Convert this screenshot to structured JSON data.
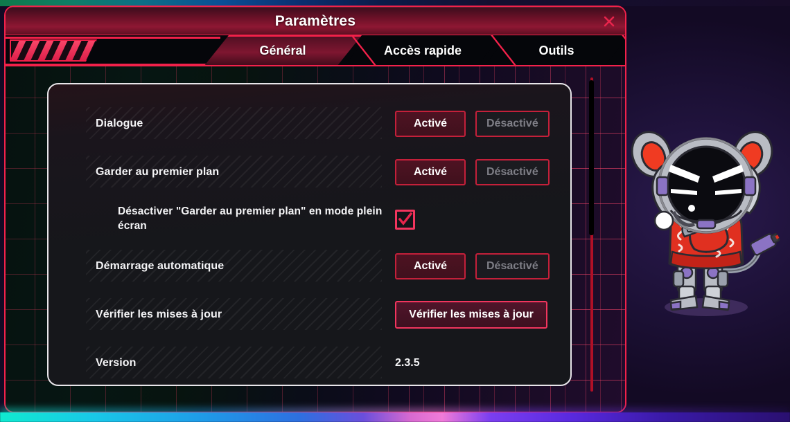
{
  "window": {
    "title": "Paramètres",
    "close_icon": "close-x-icon",
    "accent_color": "#f2214a",
    "titlebar_color": "#8e1733"
  },
  "tabs": [
    {
      "label": "Général",
      "active": true
    },
    {
      "label": "Accès rapide",
      "active": false
    },
    {
      "label": "Outils",
      "active": false
    }
  ],
  "settings": {
    "rows": [
      {
        "label": "Dialogue",
        "type": "toggle",
        "on_label": "Activé",
        "off_label": "Désactivé",
        "selected": "on"
      },
      {
        "label": "Garder au premier plan",
        "type": "toggle",
        "on_label": "Activé",
        "off_label": "Désactivé",
        "selected": "on"
      },
      {
        "label": "Désactiver \"Garder au premier plan\" en mode plein écran",
        "type": "checkbox",
        "checked": true,
        "sub": true
      },
      {
        "label": "Démarrage automatique",
        "type": "toggle",
        "on_label": "Activé",
        "off_label": "Désactivé",
        "selected": "on"
      },
      {
        "label": "Vérifier les mises à jour",
        "type": "button",
        "button_label": "Vérifier les mises à jour"
      },
      {
        "label": "Version",
        "type": "value",
        "value": "2.3.5"
      }
    ]
  },
  "scrollbar": {
    "thumb_color": "#000000",
    "track_color": "#b01026"
  },
  "mascot": {
    "name": "robot-mouse-mascot",
    "jacket_color": "#e03020",
    "helmet_color": "#b9bcc4",
    "ear_color": "#f03b22",
    "accent_color": "#7d62b8"
  }
}
